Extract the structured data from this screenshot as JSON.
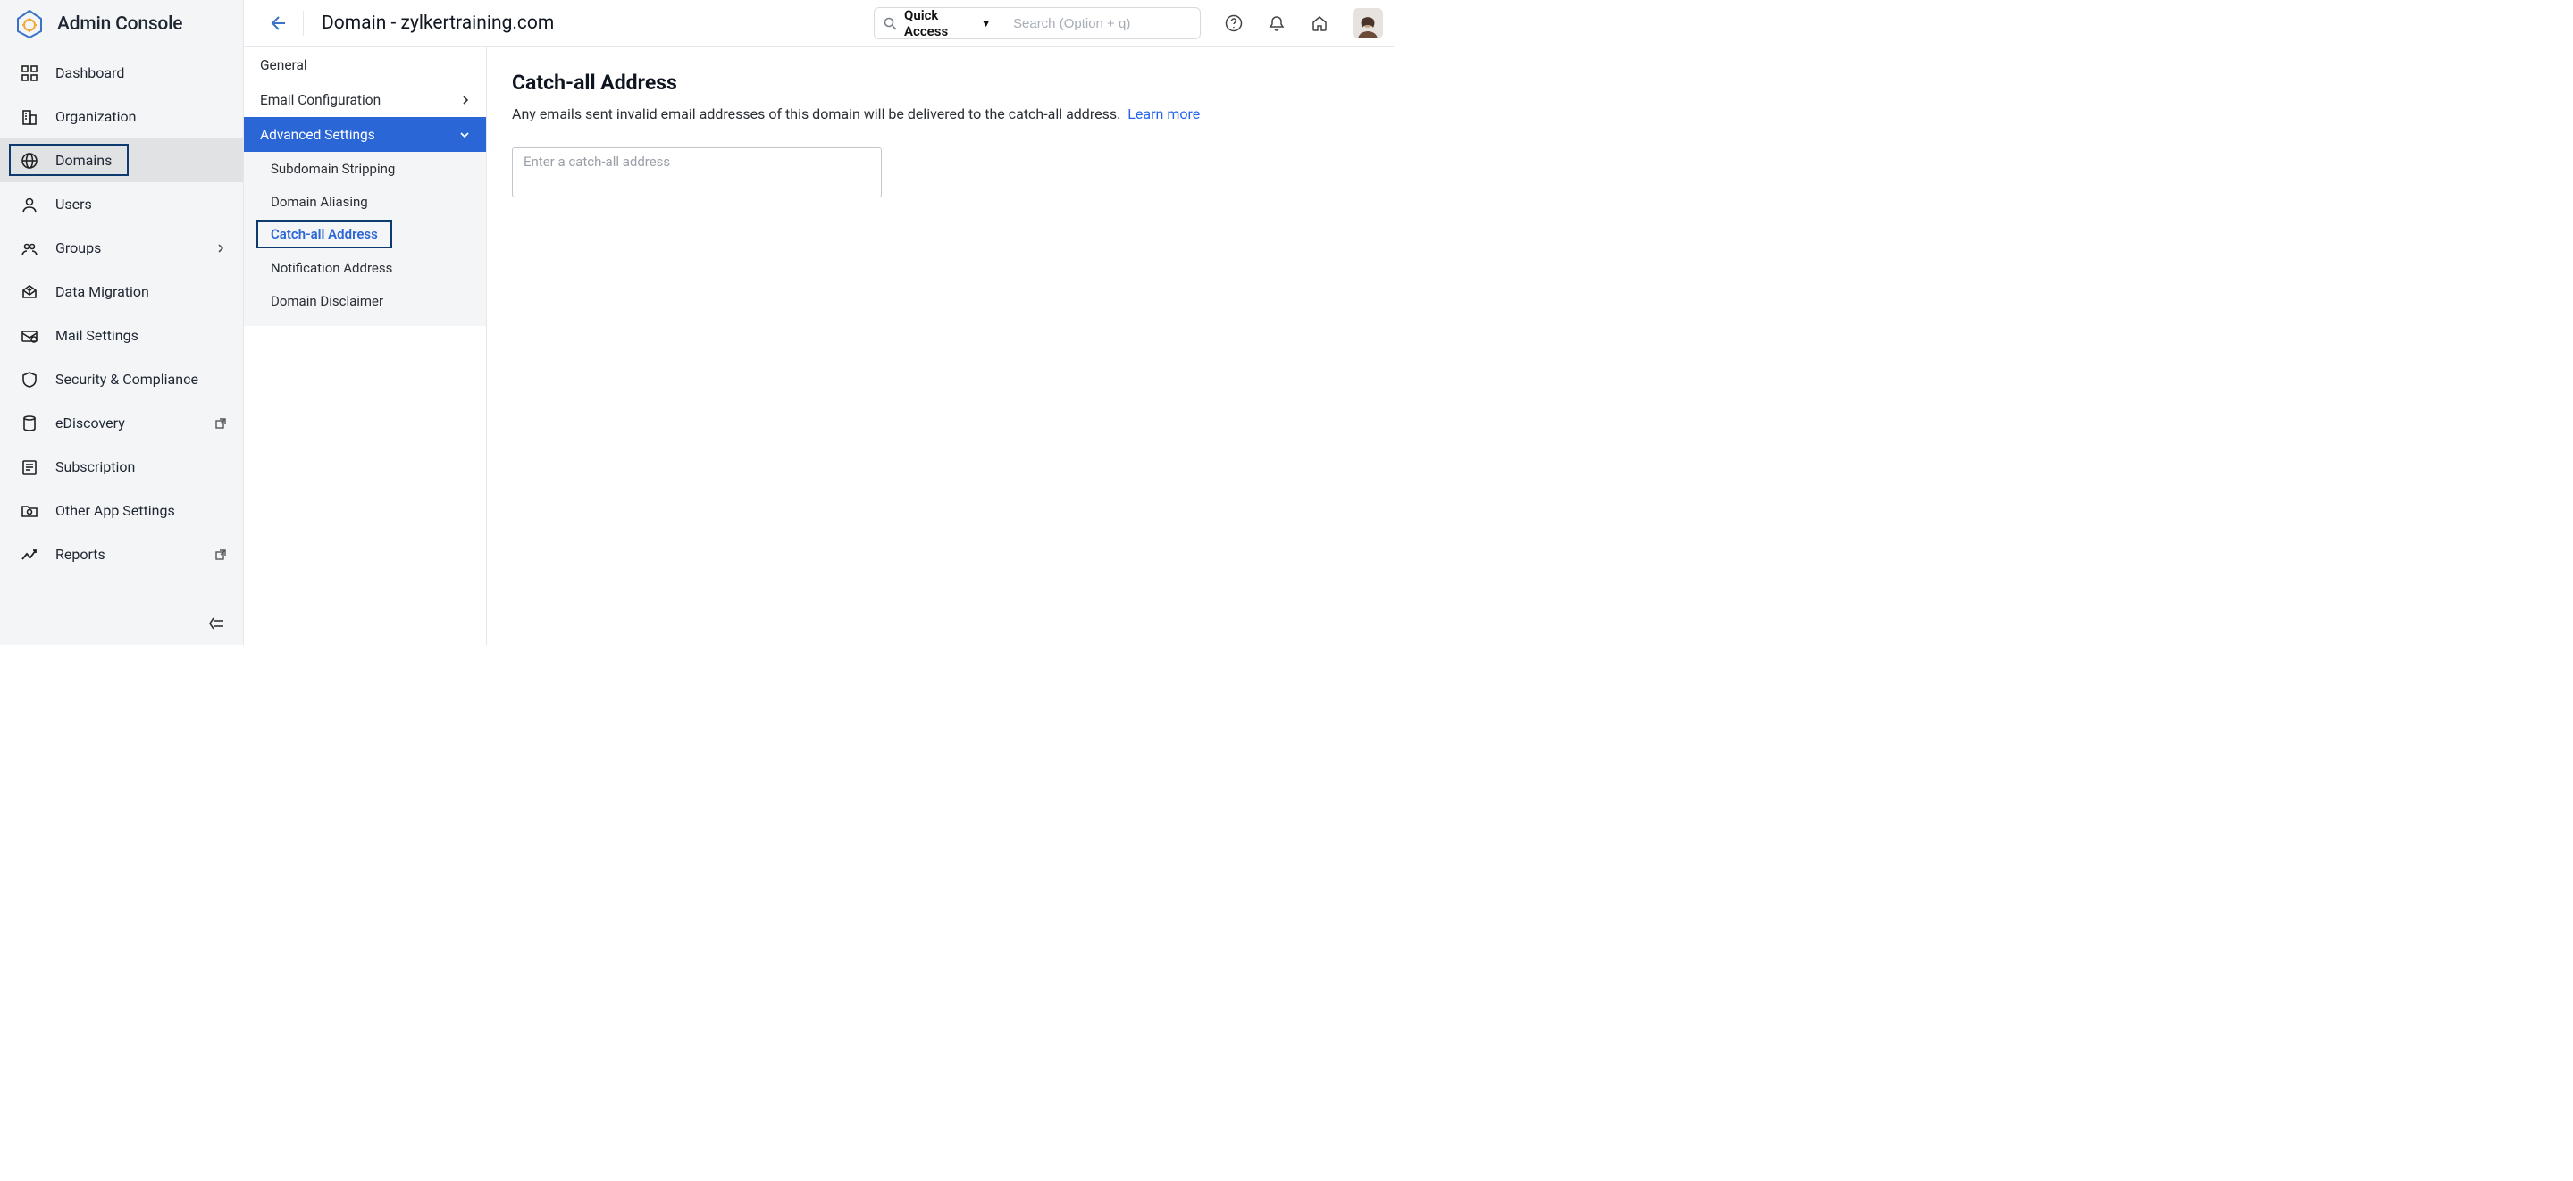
{
  "app": {
    "title": "Admin Console"
  },
  "sidebar": {
    "items": [
      {
        "label": "Dashboard"
      },
      {
        "label": "Organization"
      },
      {
        "label": "Domains"
      },
      {
        "label": "Users"
      },
      {
        "label": "Groups"
      },
      {
        "label": "Data Migration"
      },
      {
        "label": "Mail Settings"
      },
      {
        "label": "Security & Compliance"
      },
      {
        "label": "eDiscovery"
      },
      {
        "label": "Subscription"
      },
      {
        "label": "Other App Settings"
      },
      {
        "label": "Reports"
      }
    ]
  },
  "header": {
    "page_title": "Domain - zylkertraining.com",
    "quick_access_label": "Quick Access",
    "search_placeholder": "Search (Option + q)"
  },
  "subnav": {
    "general": "General",
    "email_config": "Email Configuration",
    "advanced": "Advanced Settings",
    "subitems": [
      "Subdomain Stripping",
      "Domain Aliasing",
      "Catch-all Address",
      "Notification Address",
      "Domain Disclaimer"
    ]
  },
  "main": {
    "heading": "Catch-all Address",
    "description": "Any emails sent invalid email addresses of this domain will be delivered to the catch-all address.",
    "learn_more": "Learn more",
    "input_placeholder": "Enter a catch-all address"
  }
}
